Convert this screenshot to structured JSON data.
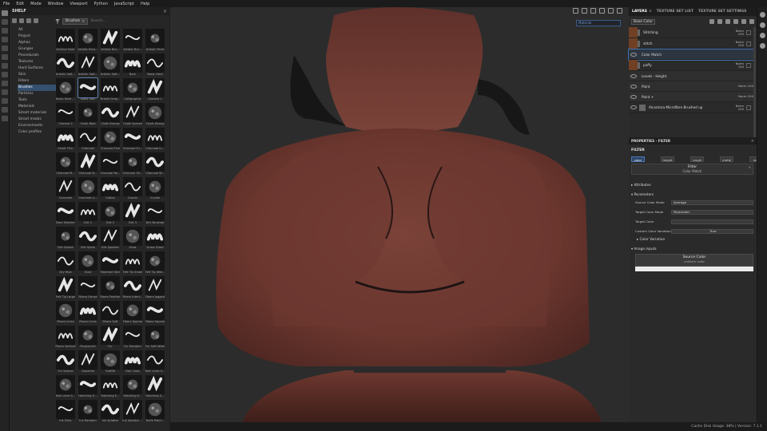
{
  "menu": [
    "File",
    "Edit",
    "Mode",
    "Window",
    "Viewport",
    "Python",
    "JavaScript",
    "Help"
  ],
  "shelf": {
    "title": "SHELF",
    "categories": [
      "All",
      "Project",
      "Alphas",
      "Grunges",
      "Procedurals",
      "Textures",
      "Hard Surfaces",
      "Skin",
      "Filters",
      "Brushes",
      "Particles",
      "Tools",
      "Materials",
      "Smart materials",
      "Smart masks",
      "Environments",
      "Color profiles"
    ],
    "selected_category": "Brushes",
    "filter_chip": "Brushes",
    "search_placeholder": "Search...",
    "items": [
      "Archive Inker",
      "Artistic Brus...",
      "Artistic Bru...",
      "Artistic Bru...",
      "Artistic Paint",
      "Artistic Soft...",
      "Artistic Soft...",
      "Artistic Soft...",
      "Bark",
      "Basic Hard",
      "Basic Hard ...",
      "Basic Soft",
      "Bristle Drag...",
      "Calligraphic",
      "Cement 1",
      "Cement 2",
      "Chalk Bold",
      "Chalk Bumpy",
      "Chalk Spread",
      "Chalk Strong",
      "Chalk Thin",
      "Charcoal",
      "Charcoal Fine",
      "Charcoal Fu...",
      "Charcoal Li...",
      "Charcoal M...",
      "Charcoal N...",
      "Charcoal Ro...",
      "Charcoal Sh...",
      "Charcoal W...",
      "Concrete",
      "Concrete Li...",
      "Cotton",
      "Cracks",
      "Crystal",
      "Dark Hatcher",
      "Dirt 1",
      "Dirt 2",
      "Dirt 3",
      "Dirt Brushed",
      "Dirt Splash",
      "Dirt Spots",
      "Dirt Splatter",
      "Glow",
      "Grass Dried",
      "Dry Mud",
      "Dust",
      "Elephant Skin",
      "Felt Tip Small",
      "Felt Tip Wid...",
      "Felt Tip Large",
      "Fibers Dense",
      "Fibers Feather",
      "Fibers Intert...",
      "Fibers Jagged",
      "Fibers Lines",
      "Fibers Lines",
      "Fibers Soft",
      "Fibers Sparse",
      "Fibers Square",
      "Fibers Vertical",
      "Fingerprint",
      "Fur",
      "Fur Random",
      "Fur Soft Wide",
      "Fur Sparse",
      "Gouache",
      "Graffiti",
      "Hair Lines",
      "Hair Lines S...",
      "Hair Lines S...",
      "Hatching G...",
      "Hatching E...",
      "Hatching S...",
      "Hatching S...",
      "Ink Dirty",
      "Ink Random",
      "Ink Splatter",
      "Ink Splatter ...",
      "Knife Paint..."
    ],
    "selected_item": "Basic Soft"
  },
  "viewport": {
    "material_dropdown": "Material",
    "axis_label": "L z"
  },
  "right_panel": {
    "tabs": [
      {
        "label": "LAYERS",
        "active": true
      },
      {
        "label": "TEXTURE SET LIST",
        "active": false
      },
      {
        "label": "TEXTURE SET SETTINGS",
        "active": false
      }
    ],
    "base_color": "Base Color",
    "layers": [
      {
        "name": "Stitching",
        "blend": "Norm",
        "opacity": "100"
      },
      {
        "name": "stitch",
        "blend": "Norm",
        "opacity": "100"
      },
      {
        "name": "Color Match",
        "blend": "",
        "opacity": ""
      },
      {
        "name": "puffy",
        "blend": "Norm",
        "opacity": "100"
      },
      {
        "name": "Levels - Height",
        "blend": "",
        "opacity": ""
      },
      {
        "name": "Paint",
        "blend": "Norm",
        "opacity": "100"
      },
      {
        "name": "Paint +",
        "blend": "Norm",
        "opacity": "100"
      },
      {
        "name": "Alcantara Microfibre Brushed up",
        "blend": "Norm",
        "opacity": "100"
      }
    ],
    "properties": {
      "title": "PROPERTIES - FILTER",
      "section_filter": "FILTER",
      "channels": [
        "color",
        "height",
        "rough",
        "metal",
        "nmr"
      ],
      "active_channel": "color",
      "filter_name": "Filter",
      "filter_sub": "Color Match",
      "attributes": "Attributes",
      "parameters": "Parameters",
      "params": [
        {
          "label": "Source Color Mode",
          "value": "Average"
        },
        {
          "label": "Target Color Mode",
          "value": "Parameter"
        },
        {
          "label": "Target Color",
          "value": ""
        },
        {
          "label": "Custom Color Variation",
          "value": "True"
        }
      ],
      "color_variation": "Color Variation",
      "image_inputs": "Image inputs",
      "source_color": "Source Color",
      "source_color_sub": "uniform color"
    }
  },
  "status": "Cache Disk Usage:  38%  |  Version: 7.1.1",
  "colors": {
    "accent": "#3d6ea8",
    "leather": "#6f3a31",
    "layer_band": "#704025"
  }
}
